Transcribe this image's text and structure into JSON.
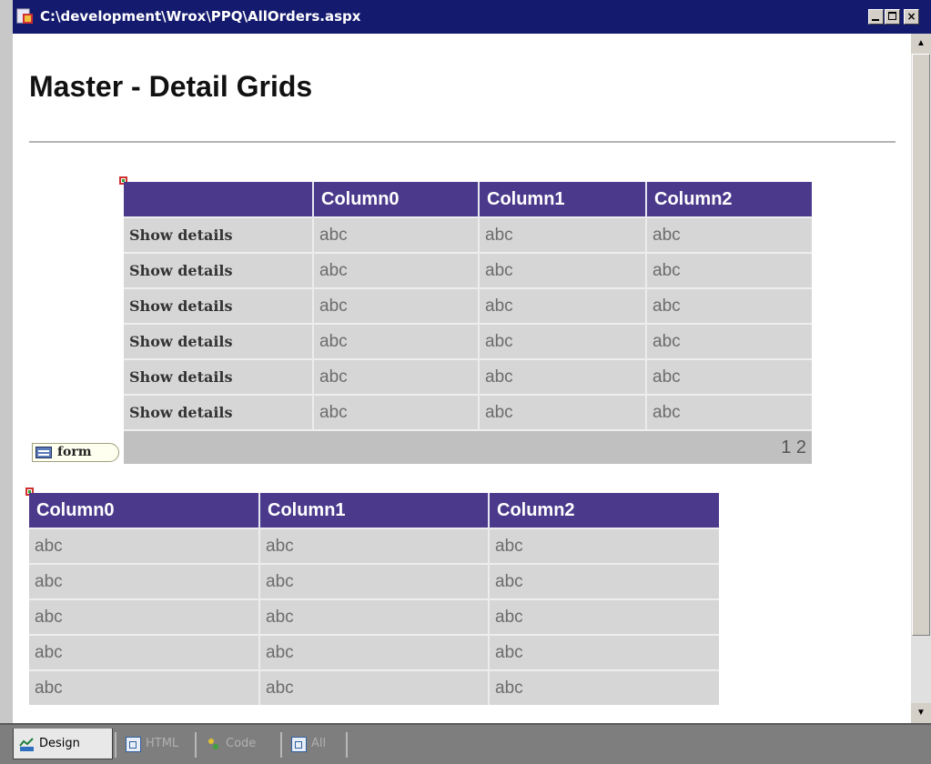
{
  "window": {
    "title": "C:\\development\\Wrox\\PPQ\\AllOrders.aspx",
    "controls": [
      "minimize",
      "maximize",
      "close"
    ],
    "close_glyph": "×"
  },
  "page": {
    "heading": "Master - Detail Grids"
  },
  "master_grid": {
    "columns": [
      "",
      "Column0",
      "Column1",
      "Column2"
    ],
    "rows": [
      [
        "Show details",
        "abc",
        "abc",
        "abc"
      ],
      [
        "Show details",
        "abc",
        "abc",
        "abc"
      ],
      [
        "Show details",
        "abc",
        "abc",
        "abc"
      ],
      [
        "Show details",
        "abc",
        "abc",
        "abc"
      ],
      [
        "Show details",
        "abc",
        "abc",
        "abc"
      ],
      [
        "Show details",
        "abc",
        "abc",
        "abc"
      ]
    ],
    "pager": "1 2"
  },
  "form_tag": {
    "label": "form",
    "icon": "form-icon"
  },
  "detail_grid": {
    "columns": [
      "Column0",
      "Column1",
      "Column2"
    ],
    "rows": [
      [
        "abc",
        "abc",
        "abc"
      ],
      [
        "abc",
        "abc",
        "abc"
      ],
      [
        "abc",
        "abc",
        "abc"
      ],
      [
        "abc",
        "abc",
        "abc"
      ],
      [
        "abc",
        "abc",
        "abc"
      ]
    ]
  },
  "view_tabs": [
    {
      "label": "Design",
      "icon": "design-icon",
      "active": true
    },
    {
      "label": "HTML",
      "icon": "html-icon",
      "active": false
    },
    {
      "label": "Code",
      "icon": "code-icon",
      "active": false
    },
    {
      "label": "All",
      "icon": "all-icon",
      "active": false
    }
  ],
  "colors": {
    "titlebar": "#141a6e",
    "grid_header": "#4b3a8c",
    "grid_row": "#d6d6d6",
    "pager": "#c0c0c0"
  }
}
